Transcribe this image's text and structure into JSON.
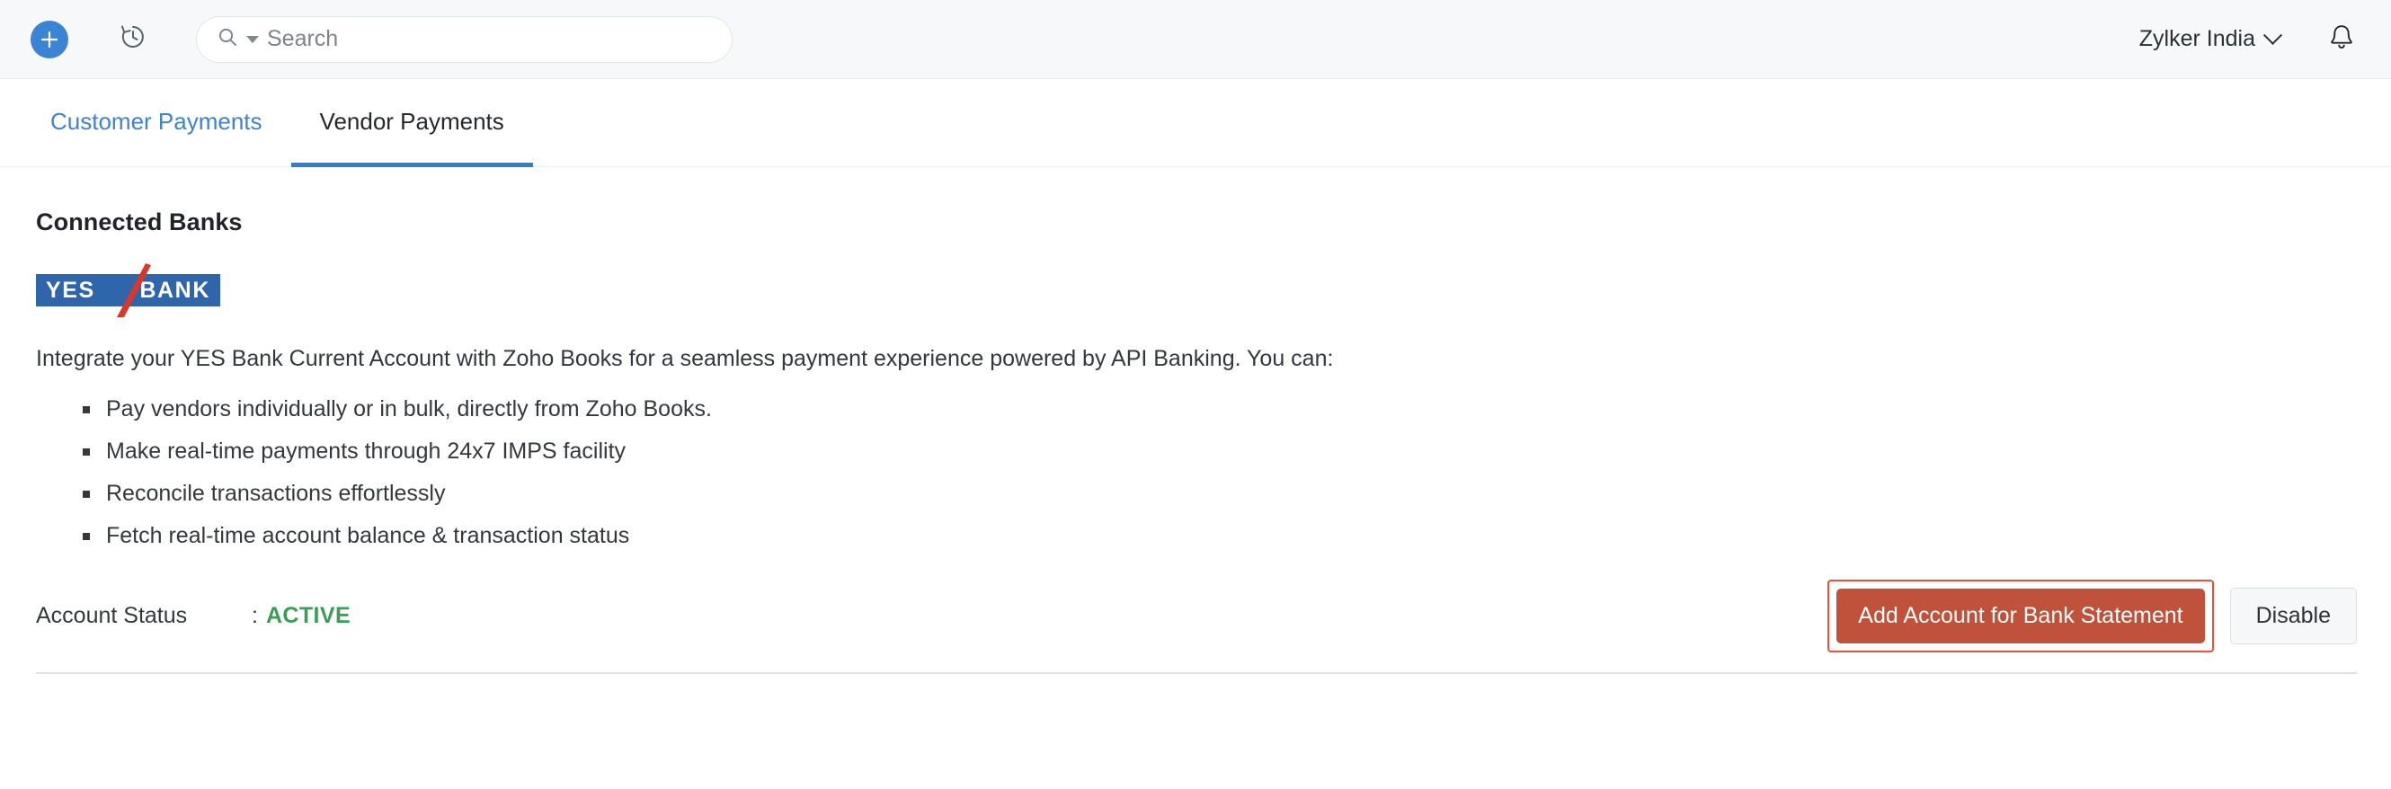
{
  "topbar": {
    "add_button_label": "+",
    "add_icon": "plus-icon",
    "history_icon": "history-clock-icon",
    "search": {
      "placeholder": "Search",
      "value": "",
      "icon": "search-icon",
      "dropdown_icon": "caret-down-icon"
    },
    "org_name": "Zylker India",
    "org_chevron_icon": "chevron-down-icon",
    "notification_icon": "bell-icon",
    "accent_blue": "#3b83d4"
  },
  "tabs": [
    {
      "label": "Customer Payments",
      "active": false
    },
    {
      "label": "Vendor Payments",
      "active": true
    }
  ],
  "main": {
    "section_title": "Connected Banks",
    "bank_logo": {
      "name": "yes-bank-logo",
      "word_1": "YES",
      "word_2": "BANK",
      "plate_color": "#2f66ab",
      "slash_color": "#d8382b",
      "text_color": "#ffffff"
    },
    "intro_text": "Integrate your YES Bank Current Account with Zoho Books for a seamless payment experience powered by API Banking. You can:",
    "features": [
      "Pay vendors individually or in bulk, directly from Zoho Books.",
      "Make real-time payments through 24x7 IMPS facility",
      "Reconcile transactions effortlessly",
      "Fetch real-time account balance & transaction status"
    ],
    "status": {
      "label": "Account Status",
      "separator": ":",
      "value": "ACTIVE",
      "value_color": "#3a9e54"
    },
    "actions": {
      "primary_label": "Add Account for Bank Statement",
      "primary_color": "#c0513b",
      "primary_outline_color": "#e5533d",
      "secondary_label": "Disable"
    }
  }
}
